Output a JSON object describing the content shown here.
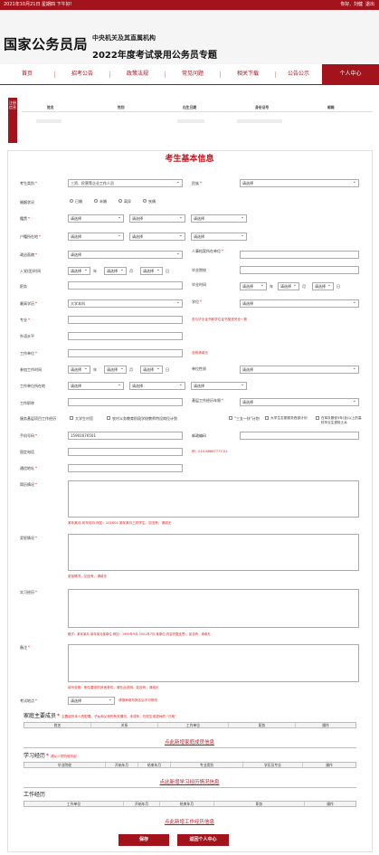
{
  "topbar": {
    "date": "2021年10月21日 星期四 下午好!",
    "greeting": "你好,",
    "user": "刘健",
    "logout": "退出"
  },
  "banner": {
    "brand": "国家公务员局",
    "org": "中央机关及其直属机构",
    "subtitle": "2022年度考试录用公务员专题"
  },
  "nav": {
    "items": [
      "首页",
      "招考公告",
      "政策法规",
      "常见问题",
      "相关下载",
      "公告公示",
      "个人中心"
    ],
    "active": "个人中心"
  },
  "notice": {
    "tag": "注册信息",
    "columns": [
      "姓名",
      "性别",
      "出生日期",
      "身份证号",
      "邮箱"
    ]
  },
  "form": {
    "title": "考生基本信息",
    "placeholder_select": "请选择",
    "labels": {
      "category": "考生类别",
      "ethnicity": "民族",
      "marital": "婚姻状况",
      "native": "籍贯",
      "hukou": "户籍所在地",
      "political": "政治面貌",
      "archive": "人事档案所在单位",
      "join_party": "入党(团)时间",
      "grad_school": "毕业院校",
      "post": "职务",
      "grad_time": "毕业时间",
      "education": "最高学历",
      "degree": "学位",
      "major": "专业",
      "foreign_lang": "外语水平",
      "work_unit": "工作单位",
      "work_start": "参加工作时间",
      "unit_nature": "单位性质",
      "unit_location": "工作单位所在地",
      "job_title": "工作职称",
      "grassroots_years": "基层工作经历年限",
      "service_project": "服务基层项目工作经历",
      "mobile": "手机号码",
      "postcode": "邮政编码",
      "landline": "固定电话",
      "address": "通信地址",
      "resume": "简历情况",
      "family_info": "奖惩情况",
      "practice": "实习经历",
      "remark": "备注",
      "exam_site": "考试地点"
    },
    "category_value": "三资、民营等企业工作人员",
    "education_value": "大学本科",
    "mobile_value": "15901676501",
    "marital_options": [
      "已婚",
      "未婚",
      "离异",
      "丧偶"
    ],
    "service_options": [
      "大学生村官",
      "农村义务教育阶段学校教师特设岗位计划",
      "\"三支一扶\"计划",
      "大学生志愿服务西部计划",
      "在军队服役5年(含)以上的高校毕业生退役士兵"
    ],
    "units": {
      "year": "年",
      "month": "月",
      "day": "日"
    },
    "hints": {
      "major": "查与毕业证书和学位证书描述完全一致",
      "work_unit": "没有请填无",
      "landline": "例：010-88887777-01",
      "resume": "某年某月-何年何月 例如：201604 某年某月三好学生。如没有，请填无",
      "family": "奖惩情况，如没有，请填无",
      "practice": "格式：某年某月-某年某月某单位 例如：1999年9月-2001年7月 某单位(内容完整连贯)，如没有，请填无",
      "remark": "填写说明：职位要求的其他条件，请在此说明。如没有，请填无",
      "exam_site": "请慎审填写报名后不可修改"
    }
  },
  "family": {
    "title": "家庭主要成员",
    "note": "主要填写本人的配偶、子女和父母的有关情况，未成年、在校生或退休的 “已故”",
    "columns": [
      "姓名",
      "关系",
      "工作单位",
      "职务",
      "操作"
    ],
    "add": "点此新增家庭成员信息"
  },
  "study": {
    "title": "学习经历",
    "note": "请从小学阶段写起",
    "columns": [
      "毕业院校",
      "开始年月",
      "结束年月",
      "专业类别",
      "学历及专业",
      "操作"
    ],
    "add": "点此新增学习经历情况信息"
  },
  "work": {
    "title": "工作经历",
    "columns": [
      "工作单位",
      "开始年月",
      "结束年月",
      "职务",
      "操作"
    ],
    "add": "点此新增工作经历信息"
  },
  "buttons": {
    "save": "保存",
    "back": "返回个人中心"
  },
  "colors": {
    "brand_red": "#a3131c",
    "title_red": "#c0141e"
  }
}
